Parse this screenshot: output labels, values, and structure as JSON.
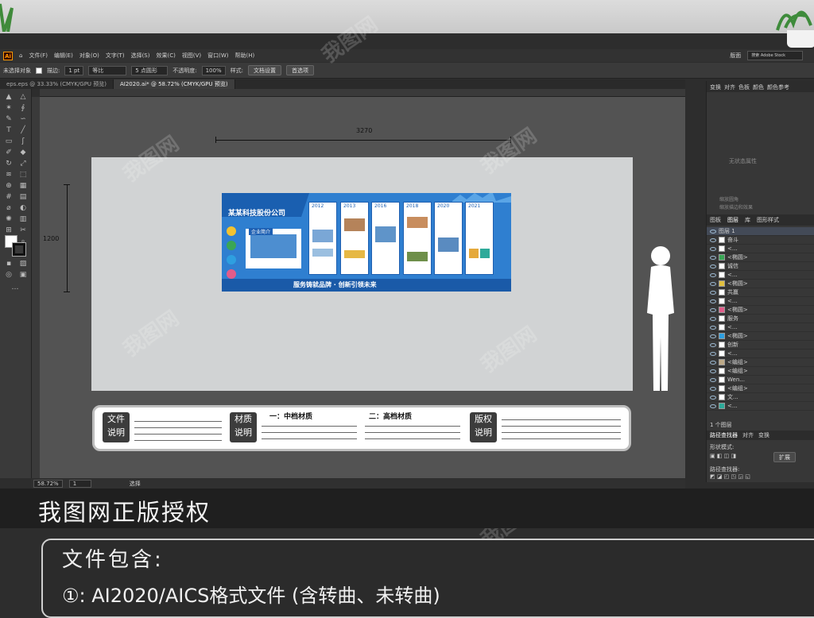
{
  "app": {
    "logo": "Ai",
    "workspace": "版面",
    "search_placeholder": "搜索 Adobe Stock"
  },
  "menu": [
    "文件(F)",
    "编辑(E)",
    "对象(O)",
    "文字(T)",
    "选择(S)",
    "效果(C)",
    "视图(V)",
    "窗口(W)",
    "帮助(H)"
  ],
  "control": {
    "no_selection": "未选择对象",
    "stroke_label": "描边:",
    "stroke_value": "1 pt",
    "line_style": "等比",
    "brush": "5 点圆形",
    "opacity_label": "不透明度:",
    "opacity_value": "100%",
    "style_label": "样式:",
    "doc_setup": "文档设置",
    "preferences": "首选项"
  },
  "tabs": [
    {
      "label": "eps.eps @ 33.33% (CMYK/GPU 预览)"
    },
    {
      "label": "AI2020.ai* @ 58.72% (CMYK/GPU 预览)"
    }
  ],
  "canvas": {
    "width_dim": "3270",
    "height_dim": "1200"
  },
  "board": {
    "company": "某某科技股份公司",
    "intro": "企业简介",
    "years": [
      "2012",
      "2013",
      "2016",
      "2018",
      "2020",
      "2021"
    ],
    "slogan": "服务铸就品牌 · 创新引领未来"
  },
  "notes": {
    "file": "文件\n说明",
    "material": "材质\n说明",
    "mid": "一：中档材质",
    "high": "二：高档材质",
    "copyright": "版权\n说明"
  },
  "status": {
    "zoom": "58.72%",
    "page": "1",
    "mode": "选择"
  },
  "panel": {
    "tabs1": [
      "变换",
      "对齐",
      "色板",
      "颜色",
      "颜色参考"
    ],
    "tabs2": [
      "图板",
      "图层",
      "库",
      "图形样式"
    ],
    "layer_top": "图层 1",
    "layers": [
      "奋斗",
      "<...",
      "<椭圆>",
      "诚信",
      "<...",
      "<椭圆>",
      "共赢",
      "<...",
      "<椭圆>",
      "服务",
      "<...",
      "<椭圆>",
      "创新",
      "<...",
      "<编组>",
      "<编组>",
      "Wen...",
      "<编组>",
      "文...",
      "<..."
    ],
    "layer_count": "1 个图层",
    "path_finder": "路径查找器",
    "align": "对齐",
    "transform": "变换",
    "shape_mode": "形状模式:",
    "expand": "扩展",
    "path_finder_label": "路径查找器:",
    "no_state": "无状态属性",
    "checkbox1": "缩放圆角",
    "checkbox2": "缩放描边和效果"
  },
  "banner": "我图网正版授权",
  "info": {
    "title": "文件包含:",
    "line": "①: AI2020/AICS格式文件 (含转曲、未转曲)"
  },
  "watermark": "我图网"
}
